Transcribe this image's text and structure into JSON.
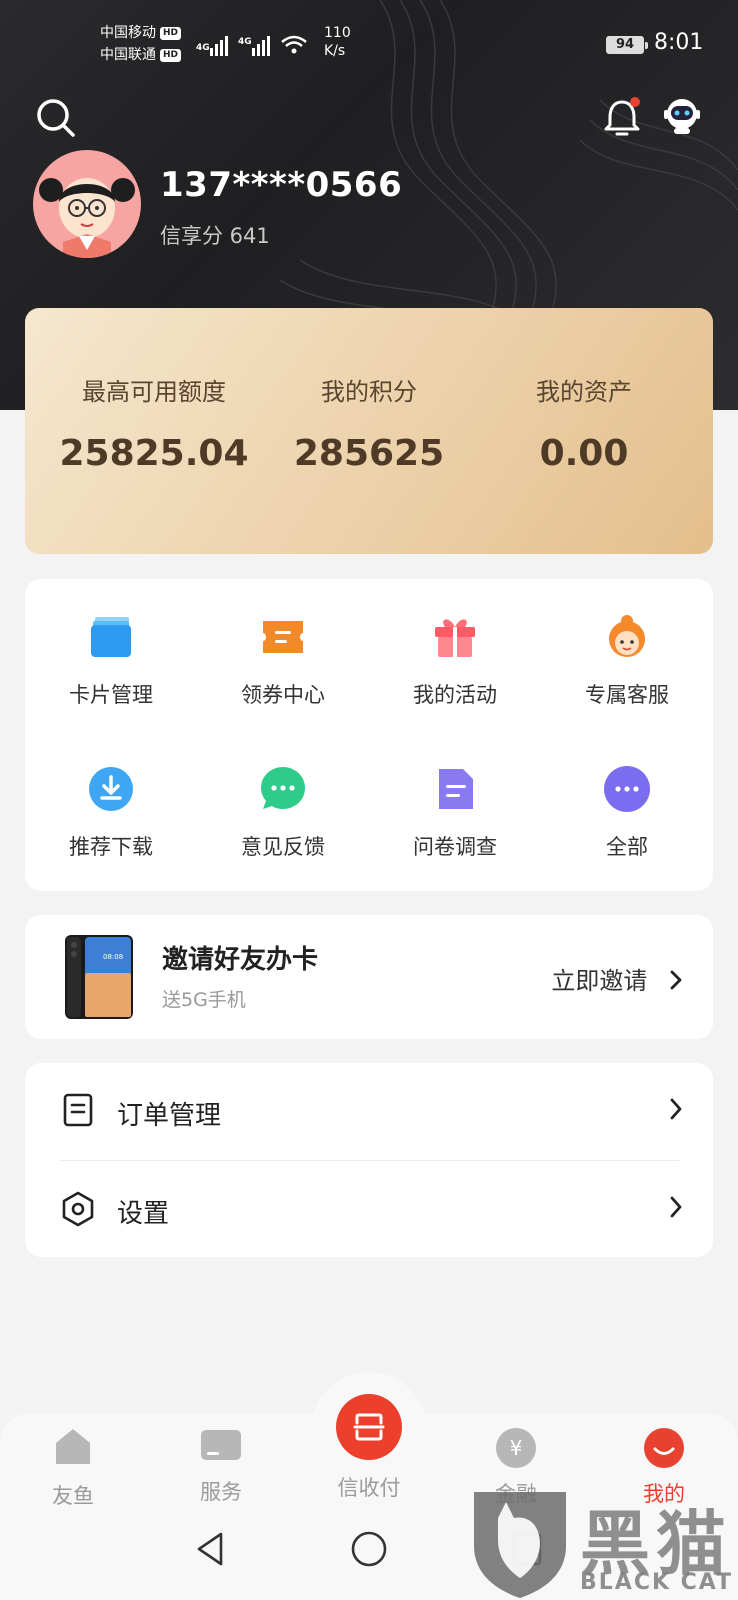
{
  "status_bar": {
    "carrier_1": "中国移动",
    "carrier_2": "中国联通",
    "hd_badge": "HD",
    "network": "4G",
    "speed_value": "110",
    "speed_unit": "K/s",
    "battery": "94",
    "time": "8:01"
  },
  "header": {
    "phone": "137****0566",
    "credit_score": "信享分 641",
    "notification_dot_color": "#e9412f"
  },
  "summary": {
    "items": [
      {
        "label": "最高可用额度",
        "value": "25825.04"
      },
      {
        "label": "我的积分",
        "value": "285625"
      },
      {
        "label": "我的资产",
        "value": "0.00"
      }
    ]
  },
  "services": {
    "items": [
      {
        "label": "卡片管理",
        "icon": "card-icon"
      },
      {
        "label": "领券中心",
        "icon": "coupon-icon"
      },
      {
        "label": "我的活动",
        "icon": "gift-icon"
      },
      {
        "label": "专属客服",
        "icon": "customer-service-icon"
      },
      {
        "label": "推荐下载",
        "icon": "download-icon"
      },
      {
        "label": "意见反馈",
        "icon": "feedback-icon"
      },
      {
        "label": "问卷调查",
        "icon": "survey-icon"
      },
      {
        "label": "全部",
        "icon": "more-icon"
      }
    ]
  },
  "invite": {
    "title": "邀请好友办卡",
    "subtitle": "送5G手机",
    "action": "立即邀请"
  },
  "menu": {
    "items": [
      {
        "label": "订单管理",
        "icon": "order-icon"
      },
      {
        "label": "设置",
        "icon": "settings-icon"
      }
    ]
  },
  "tabbar": {
    "items": [
      {
        "label": "友鱼",
        "icon": "home-icon"
      },
      {
        "label": "服务",
        "icon": "service-icon"
      },
      {
        "label": "信收付",
        "icon": "scan-pay-icon"
      },
      {
        "label": "金融",
        "icon": "finance-icon"
      },
      {
        "label": "我的",
        "icon": "profile-icon",
        "active": true
      }
    ],
    "active_color": "#e9412f"
  },
  "watermark": {
    "cn": "黑猫",
    "en": "BLACK CAT"
  }
}
